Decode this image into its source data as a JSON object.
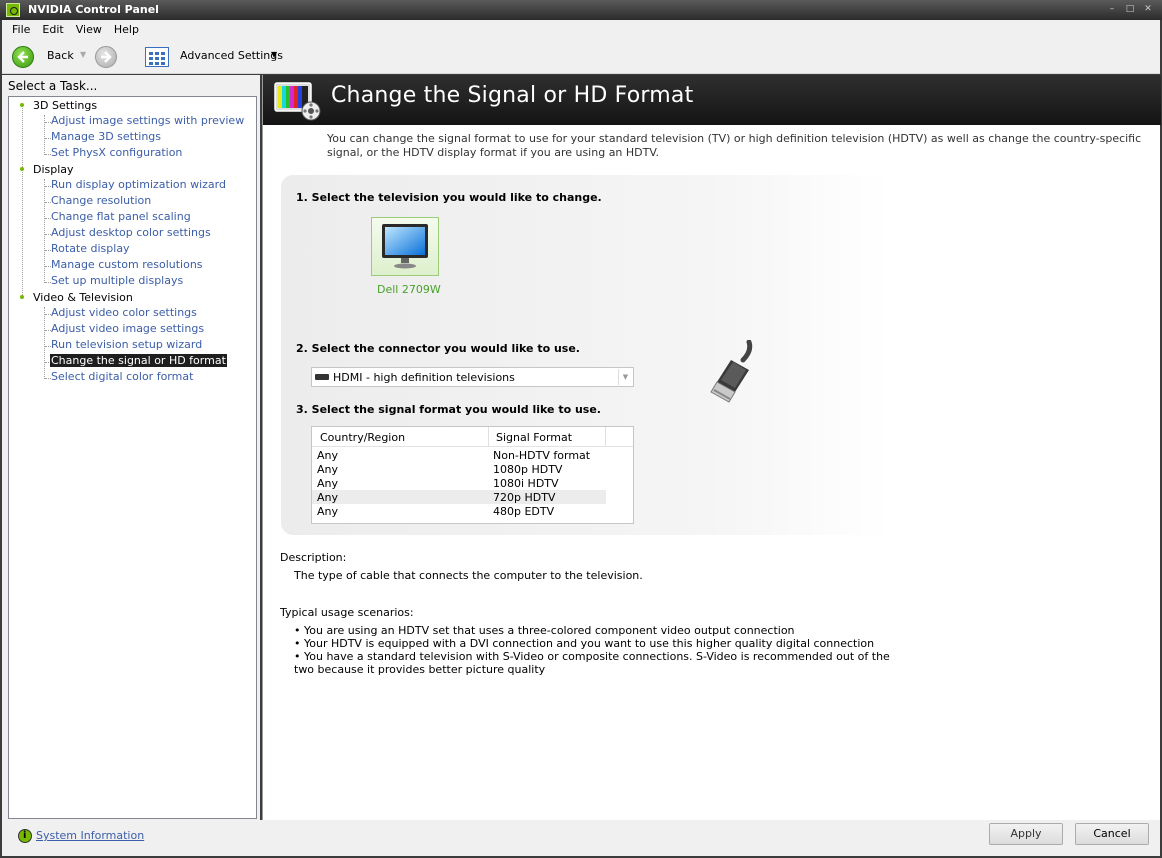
{
  "window": {
    "title": "NVIDIA Control Panel"
  },
  "menu": [
    "File",
    "Edit",
    "View",
    "Help"
  ],
  "toolbar": {
    "back_label": "Back",
    "advanced_label": "Advanced Settings"
  },
  "sidebar": {
    "heading": "Select a Task...",
    "categories": [
      {
        "label": "3D Settings",
        "items": [
          "Adjust image settings with preview",
          "Manage 3D settings",
          "Set PhysX configuration"
        ]
      },
      {
        "label": "Display",
        "items": [
          "Run display optimization wizard",
          "Change resolution",
          "Change flat panel scaling",
          "Adjust desktop color settings",
          "Rotate display",
          "Manage custom resolutions",
          "Set up multiple displays"
        ]
      },
      {
        "label": "Video & Television",
        "items": [
          "Adjust video color settings",
          "Adjust video image settings",
          "Run television setup wizard",
          "Change the signal or HD format",
          "Select digital color format"
        ]
      }
    ],
    "selected_item": "Change the signal or HD format"
  },
  "page": {
    "title": "Change the Signal or HD Format",
    "intro": "You can change the signal format to use for your standard television (TV) or high definition television (HDTV) as well as change the country-specific signal, or the HDTV display format if you are using an HDTV.",
    "step1": "1. Select the television you would like to change.",
    "tv_name": "Dell 2709W",
    "step2": "2. Select the connector you would like to use.",
    "connector_value": "HDMI - high definition televisions",
    "step3": "3. Select the signal format you would like to use.",
    "table": {
      "headers": [
        "Country/Region",
        "Signal Format"
      ],
      "rows": [
        [
          "Any",
          "Non-HDTV format"
        ],
        [
          "Any",
          "1080p HDTV"
        ],
        [
          "Any",
          "1080i HDTV"
        ],
        [
          "Any",
          "720p HDTV"
        ],
        [
          "Any",
          "480p EDTV"
        ]
      ],
      "highlighted_row": 3
    },
    "description_heading": "Description:",
    "description": "The type of cable that connects the computer to the television.",
    "usage_heading": "Typical usage scenarios:",
    "usage": [
      "• You are using an HDTV set that uses a three-colored component video output connection",
      "• Your HDTV is equipped with a DVI connection and you want to use this higher quality digital connection",
      "• You have a standard television with S-Video or composite connections. S-Video is recommended out of the two because it provides better picture quality"
    ]
  },
  "footer": {
    "system_info": "System Information",
    "apply": "Apply",
    "cancel": "Cancel"
  },
  "colors": {
    "nvidia_green": "#76b900",
    "link_blue": "#3b5ea8",
    "header_bg": "#1e1e1e"
  }
}
